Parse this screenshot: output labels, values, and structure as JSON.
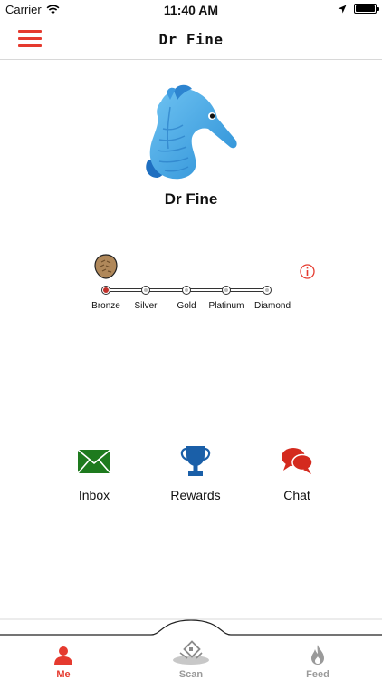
{
  "status_bar": {
    "carrier": "Carrier",
    "time": "11:40 AM"
  },
  "nav": {
    "title": "Dr Fine",
    "menu_icon": "hamburger-icon"
  },
  "profile": {
    "name": "Dr Fine",
    "avatar_icon": "seahorse-avatar"
  },
  "tiers": {
    "current": "Bronze",
    "items": [
      {
        "label": "Bronze"
      },
      {
        "label": "Silver"
      },
      {
        "label": "Gold"
      },
      {
        "label": "Platinum"
      },
      {
        "label": "Diamond"
      }
    ],
    "info_icon": "info-icon"
  },
  "actions": [
    {
      "label": "Inbox",
      "icon": "envelope-icon",
      "color": "#1e7a1e"
    },
    {
      "label": "Rewards",
      "icon": "trophy-icon",
      "color": "#1a5fa8"
    },
    {
      "label": "Chat",
      "icon": "chat-bubbles-icon",
      "color": "#d42a1e"
    }
  ],
  "tab_bar": {
    "tabs": [
      {
        "label": "Me",
        "icon": "person-icon",
        "active": true
      },
      {
        "label": "Scan",
        "icon": "scan-icon",
        "active": false
      },
      {
        "label": "Feed",
        "icon": "flame-icon",
        "active": false
      }
    ]
  },
  "colors": {
    "accent": "#e53a2f",
    "inactive": "#9a9a9a"
  }
}
